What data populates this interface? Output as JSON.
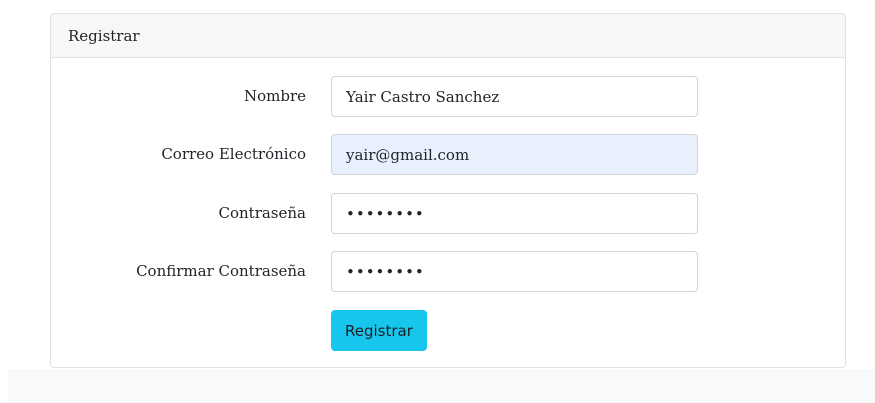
{
  "card": {
    "header_title": "Registrar"
  },
  "form": {
    "fields": [
      {
        "label": "Nombre",
        "value": "Yair Castro Sanchez",
        "type": "text"
      },
      {
        "label": "Correo Electrónico",
        "value": "yair@gmail.com",
        "type": "email"
      },
      {
        "label": "Contraseña",
        "value": "••••••••",
        "type": "password"
      },
      {
        "label": "Confirmar Contraseña",
        "value": "••••••••",
        "type": "password"
      }
    ],
    "submit_label": "Registrar"
  },
  "colors": {
    "button_bg": "#17c6ed",
    "autofill_bg": "#e8f0fe",
    "header_bg": "#f7f7f7"
  }
}
